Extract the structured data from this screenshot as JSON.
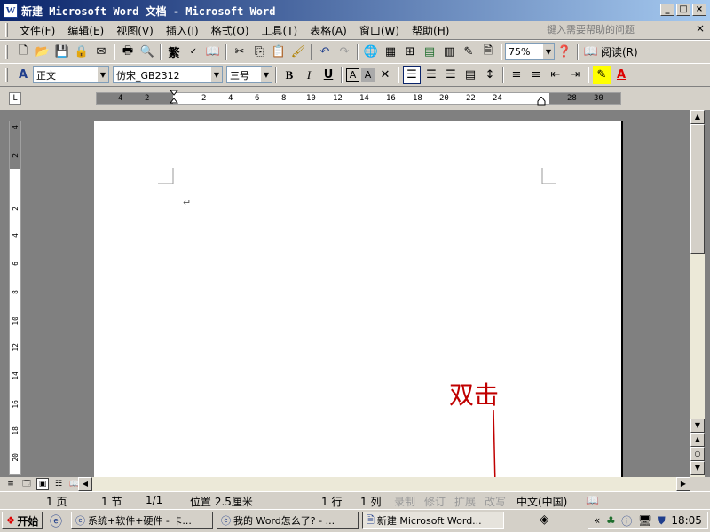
{
  "window": {
    "title": "新建 Microsoft Word 文档 - Microsoft Word",
    "app_icon": "W"
  },
  "menubar": {
    "items": [
      "文件(F)",
      "编辑(E)",
      "视图(V)",
      "插入(I)",
      "格式(O)",
      "工具(T)",
      "表格(A)",
      "窗口(W)",
      "帮助(H)"
    ],
    "help_placeholder": "键入需要帮助的问题",
    "close": "×"
  },
  "standard_toolbar": {
    "zoom": "75%",
    "read_label": "阅读(R)"
  },
  "format_toolbar": {
    "style": "正文",
    "font": "仿宋_GB2312",
    "size": "三号",
    "bold": "B",
    "italic": "I",
    "underline": "U"
  },
  "ruler": {
    "h_labels": [
      "4",
      "2",
      "2",
      "4",
      "6",
      "8",
      "10",
      "12",
      "14",
      "16",
      "18",
      "20",
      "22",
      "24",
      "28",
      "30"
    ],
    "v_labels": [
      "4",
      "2",
      "2",
      "4",
      "6",
      "8",
      "10",
      "12",
      "14",
      "16",
      "18",
      "20"
    ]
  },
  "document": {
    "paragraph_mark": "↵",
    "annotation": "双击",
    "annotation_color": "#c00000"
  },
  "statusbar": {
    "page": "1 页",
    "section": "1 节",
    "page_of": "1/1",
    "position": "位置 2.5厘米",
    "line": "1 行",
    "column": "1 列",
    "rec": "录制",
    "trk": "修订",
    "ext": "扩展",
    "ovr": "改写",
    "language": "中文(中国)"
  },
  "taskbar": {
    "start": "开始",
    "tasks": [
      "系统+软件+硬件 - 卡...",
      "我的 Word怎么了? - ...",
      "新建 Microsoft Word..."
    ],
    "clock": "18:05"
  }
}
